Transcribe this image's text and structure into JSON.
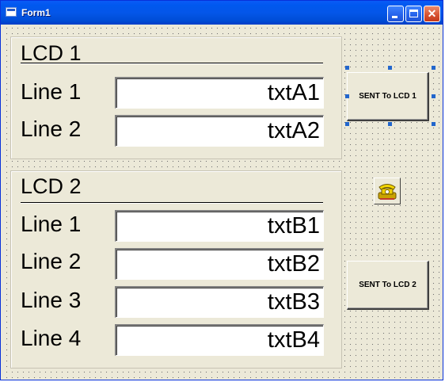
{
  "window": {
    "title": "Form1",
    "icon": "form-icon",
    "controls": [
      "minimize-icon",
      "maximize-icon",
      "close-icon"
    ]
  },
  "lcd1": {
    "title": "LCD 1",
    "lines": [
      {
        "label": "Line 1",
        "value": "txtA1"
      },
      {
        "label": "Line 2",
        "value": "txtA2"
      }
    ]
  },
  "lcd2": {
    "title": "LCD 2",
    "lines": [
      {
        "label": "Line 1",
        "value": "txtB1"
      },
      {
        "label": "Line 2",
        "value": "txtB2"
      },
      {
        "label": "Line 3",
        "value": "txtB3"
      },
      {
        "label": "Line 4",
        "value": "txtB4"
      }
    ]
  },
  "buttons": {
    "send_lcd1": "SENT To LCD 1",
    "send_lcd2": "SENT To LCD 2"
  },
  "phone_control": {
    "icon": "telephone-icon"
  },
  "colors": {
    "titlebar": "#0054e3",
    "form_background": "#ece9d8",
    "selection_handle": "#2266cc",
    "close_button": "#d6502f"
  }
}
